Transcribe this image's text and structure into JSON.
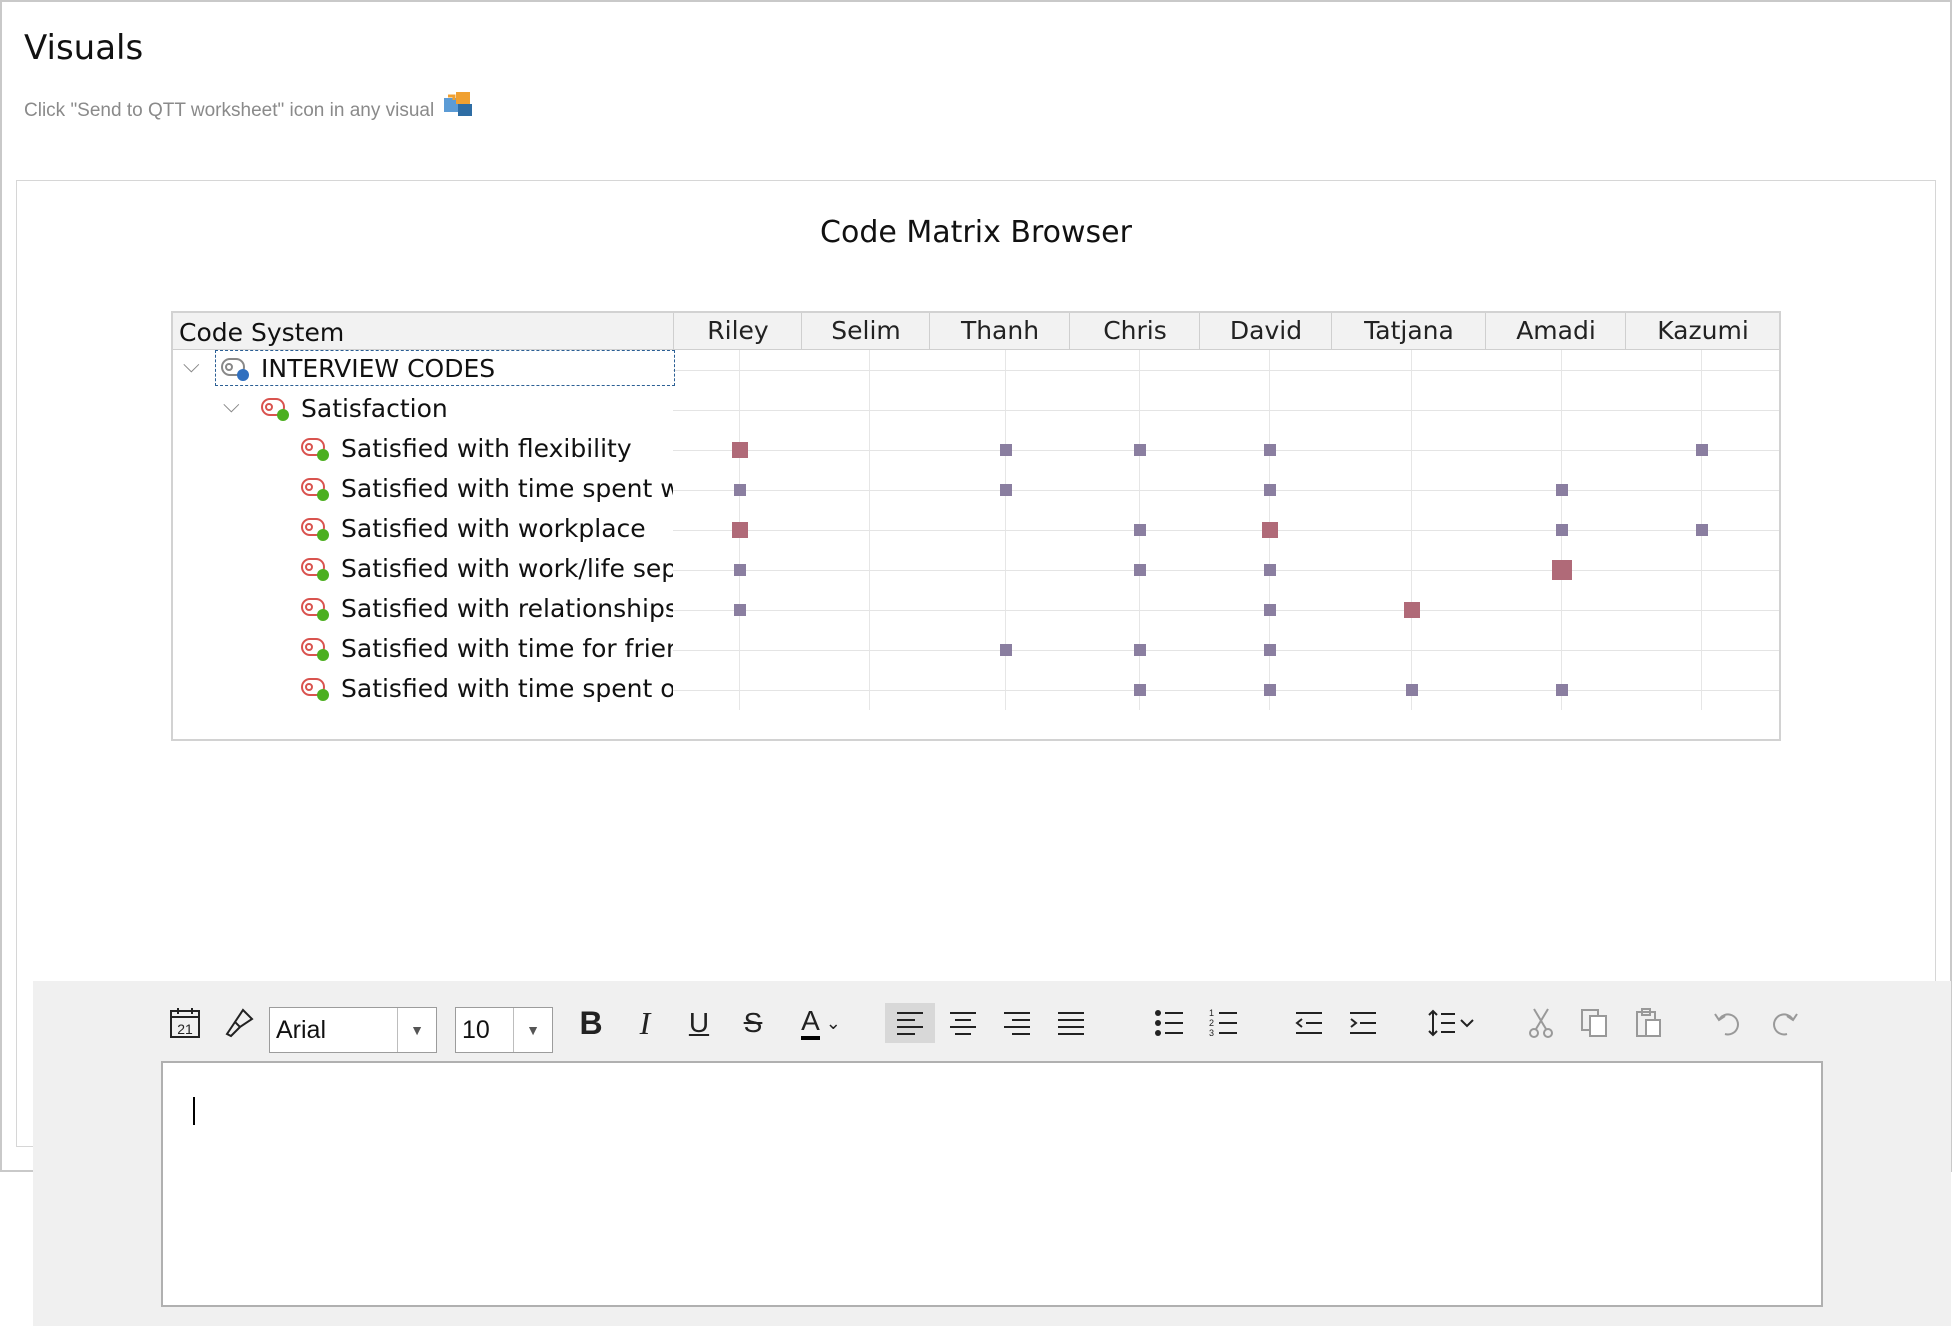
{
  "page": {
    "title": "Visuals",
    "hint": "Click \"Send to QTT worksheet\" icon in any visual"
  },
  "visual": {
    "title": "Code Matrix Browser",
    "code_system_header": "Code System",
    "columns": [
      "Riley",
      "Selim",
      "Thanh",
      "Chris",
      "David",
      "Tatjana",
      "Amadi",
      "Kazumi"
    ],
    "root": "INTERVIEW CODES",
    "group": "Satisfaction",
    "rows": [
      {
        "label": "Satisfied with flexibility",
        "cells": [
          2,
          0,
          1,
          1,
          1,
          0,
          0,
          1
        ]
      },
      {
        "label": "Satisfied with time spent w",
        "cells": [
          1,
          0,
          1,
          0,
          1,
          0,
          1,
          0
        ]
      },
      {
        "label": "Satisfied with workplace",
        "cells": [
          2,
          0,
          0,
          1,
          2,
          0,
          1,
          1
        ]
      },
      {
        "label": "Satisfied with work/life sep",
        "cells": [
          1,
          0,
          0,
          1,
          1,
          0,
          3,
          0
        ]
      },
      {
        "label": "Satisfied with relationships",
        "cells": [
          1,
          0,
          0,
          0,
          1,
          2,
          0,
          0
        ]
      },
      {
        "label": "Satisfied with time for frien",
        "cells": [
          0,
          0,
          1,
          1,
          1,
          0,
          0,
          0
        ]
      },
      {
        "label": "Satisfied with time spent or",
        "cells": [
          0,
          0,
          0,
          1,
          1,
          1,
          1,
          0
        ]
      }
    ],
    "colors": {
      "small": "#8a7ea0",
      "large": "#b06a78",
      "icon_red": "#d9534f",
      "icon_green": "#4caf20",
      "icon_blue": "#2f6fbf"
    }
  },
  "toolbar": {
    "font": "Arial",
    "size": "10",
    "calendar_day": "21",
    "numbered_digits": "123"
  },
  "editor": {
    "content": ""
  }
}
